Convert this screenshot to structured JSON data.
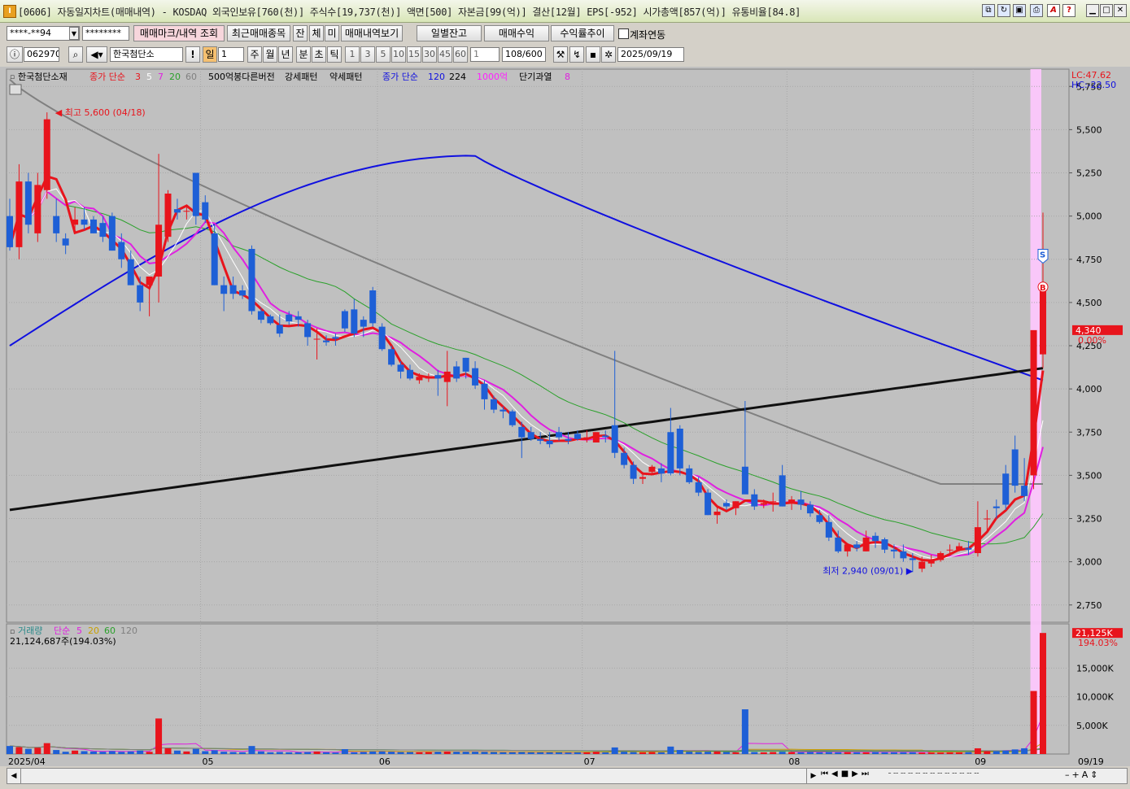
{
  "window": {
    "title": "[0606] 자동일지차트(매매내역) - KOSDAQ 외국인보유[760(천)] 주식수[19,737(천)] 액면[500] 자본금[99(억)] 결산[12월] EPS[-952] 시가총액[857(억)] 유통비율[84.8]",
    "app_icon": "I"
  },
  "toolbar1": {
    "account": "****-**94",
    "password": "********",
    "btn_trade_mark": "매매마크/내역 조회",
    "btn_recent": "최근매매종목",
    "btn_jan": "잔",
    "btn_che": "체",
    "btn_mi": "미",
    "btn_trade_list": "매매내역보기",
    "btn_daily_balance": "일별잔고",
    "btn_trade_profit": "매매수익",
    "btn_return_trend": "수익률추이",
    "chk_account_link": "계좌연동"
  },
  "toolbar2": {
    "code": "062970",
    "stock_name": "한국첨단소",
    "excl": "!",
    "period_sel": "일",
    "period_num": "1",
    "periods": [
      "주",
      "월",
      "년",
      "분",
      "초",
      "틱"
    ],
    "nums": [
      "1",
      "3",
      "5",
      "10",
      "15",
      "30",
      "45",
      "60"
    ],
    "num_sel": "1",
    "count": "108",
    "count_max": "/600",
    "date": "2025/09/19"
  },
  "legend_main": {
    "stock": "한국첨단소재",
    "ma_label": "종가 단순",
    "ma_periods": [
      "3",
      "5",
      "7",
      "20",
      "60"
    ],
    "pattern1": "500억봉다른버전",
    "pattern2": "강세패턴",
    "pattern3": "약세패턴",
    "ma2_label": "종가 단순",
    "ma2_periods": [
      "120",
      "224"
    ],
    "big": "1000억",
    "overheat": "단기과열",
    "overheat_n": "8",
    "lc": "LC:47.62",
    "hc": "HC:-22.50"
  },
  "legend_vol": {
    "label": "거래량",
    "ma_label": "단순",
    "periods": [
      "5",
      "20",
      "60",
      "120"
    ],
    "current": "21,124,687주(194.03%)"
  },
  "annotations": {
    "high": "최고 5,600 (04/18)",
    "low": "최저 2,940 (09/01)",
    "price_now": "4,340",
    "price_pct": "0.00%",
    "vol_now": "21,125K",
    "vol_pct": "194.03%",
    "sell_mark": "S",
    "buy_mark": "B"
  },
  "price_axis": [
    "5,750",
    "5,500",
    "5,250",
    "5,000",
    "4,750",
    "4,500",
    "4,250",
    "4,000",
    "3,750",
    "3,500",
    "3,250",
    "3,000",
    "2,750"
  ],
  "volume_axis": [
    "15,000K",
    "10,000K",
    "5,000K"
  ],
  "date_axis": [
    "2025/04",
    "05",
    "06",
    "07",
    "08",
    "09",
    "09/19"
  ],
  "colors": {
    "up": "#e8141c",
    "down": "#1e5fd6",
    "ma3": "#e8141c",
    "ma5": "#ffffff",
    "ma7": "#e020e0",
    "ma20": "#2aa02a",
    "ma60": "#808080",
    "ma120": "#1010e0",
    "ma224": "#101010",
    "highlight": "#ffc8ff"
  },
  "chart_data": {
    "type": "candlestick",
    "title": "",
    "xlabel": "",
    "ylabel": "",
    "ylim": [
      2650,
      5850
    ],
    "volume_ylim": [
      0,
      22000
    ],
    "start_date": "2025/04",
    "candles": [
      [
        5000,
        5100,
        4800,
        4820,
        1400
      ],
      [
        4820,
        5300,
        4750,
        5200,
        1200
      ],
      [
        5200,
        5250,
        4900,
        4950,
        900
      ],
      [
        4900,
        5250,
        4850,
        5180,
        1100
      ],
      [
        5150,
        5600,
        5100,
        5560,
        1900
      ],
      [
        5000,
        5100,
        4850,
        4900,
        700
      ],
      [
        4870,
        4900,
        4780,
        4830,
        400
      ],
      [
        4950,
        5050,
        4900,
        4980,
        600
      ],
      [
        4980,
        5050,
        4920,
        4950,
        500
      ],
      [
        4980,
        5000,
        4900,
        4900,
        450
      ],
      [
        4960,
        5000,
        4850,
        4880,
        400
      ],
      [
        5000,
        5020,
        4800,
        4800,
        500
      ],
      [
        4850,
        4900,
        4700,
        4750,
        380
      ],
      [
        4750,
        4800,
        4600,
        4600,
        450
      ],
      [
        4600,
        4650,
        4450,
        4500,
        600
      ],
      [
        4600,
        4650,
        4420,
        4650,
        380
      ],
      [
        4650,
        5360,
        4500,
        4950,
        6200
      ],
      [
        4880,
        5150,
        4850,
        5130,
        1000
      ],
      [
        5040,
        5100,
        4980,
        5020,
        600
      ],
      [
        5030,
        5060,
        4980,
        5030,
        450
      ],
      [
        5250,
        5250,
        4950,
        5000,
        900
      ],
      [
        5080,
        5120,
        4960,
        4980,
        500
      ],
      [
        4900,
        4950,
        4600,
        4600,
        650
      ],
      [
        4600,
        4650,
        4450,
        4550,
        400
      ],
      [
        4600,
        4650,
        4520,
        4550,
        350
      ],
      [
        4570,
        4600,
        4520,
        4540,
        300
      ],
      [
        4810,
        4830,
        4430,
        4450,
        1400
      ],
      [
        4450,
        4470,
        4380,
        4400,
        450
      ],
      [
        4420,
        4430,
        4370,
        4380,
        300
      ],
      [
        4370,
        4430,
        4300,
        4320,
        350
      ],
      [
        4430,
        4450,
        4370,
        4390,
        300
      ],
      [
        4420,
        4450,
        4360,
        4400,
        300
      ],
      [
        4380,
        4400,
        4250,
        4300,
        350
      ],
      [
        4290,
        4350,
        4170,
        4290,
        450
      ],
      [
        4280,
        4310,
        4250,
        4270,
        300
      ],
      [
        4300,
        4320,
        4250,
        4290,
        250
      ],
      [
        4450,
        4460,
        4330,
        4350,
        850
      ],
      [
        4460,
        4520,
        4300,
        4320,
        300
      ],
      [
        4400,
        4420,
        4300,
        4360,
        350
      ],
      [
        4570,
        4590,
        4360,
        4380,
        450
      ],
      [
        4360,
        4380,
        4220,
        4230,
        450
      ],
      [
        4230,
        4250,
        4130,
        4140,
        400
      ],
      [
        4140,
        4160,
        4060,
        4100,
        350
      ],
      [
        4110,
        4140,
        4050,
        4060,
        350
      ],
      [
        4050,
        4090,
        4030,
        4070,
        300
      ],
      [
        4060,
        4090,
        4040,
        4070,
        350
      ],
      [
        4080,
        4110,
        3960,
        4060,
        400
      ],
      [
        4040,
        4220,
        3900,
        4100,
        450
      ],
      [
        4130,
        4160,
        4040,
        4060,
        400
      ],
      [
        4180,
        4180,
        4060,
        4100,
        400
      ],
      [
        4120,
        4160,
        4000,
        4020,
        400
      ],
      [
        4030,
        4050,
        3880,
        3940,
        380
      ],
      [
        3940,
        3960,
        3860,
        3880,
        350
      ],
      [
        3880,
        3900,
        3830,
        3870,
        300
      ],
      [
        3870,
        3880,
        3780,
        3790,
        300
      ],
      [
        3780,
        3810,
        3600,
        3720,
        350
      ],
      [
        3750,
        3780,
        3700,
        3710,
        300
      ],
      [
        3710,
        3750,
        3680,
        3700,
        300
      ],
      [
        3700,
        3750,
        3660,
        3680,
        300
      ],
      [
        3750,
        3780,
        3700,
        3720,
        300
      ],
      [
        3710,
        3750,
        3680,
        3700,
        250
      ],
      [
        3740,
        3760,
        3700,
        3710,
        300
      ],
      [
        3710,
        3760,
        3690,
        3720,
        300
      ],
      [
        3690,
        3750,
        3690,
        3750,
        400
      ],
      [
        3730,
        3760,
        3690,
        3720,
        300
      ],
      [
        3790,
        4220,
        3600,
        3630,
        1150
      ],
      [
        3630,
        3660,
        3540,
        3560,
        400
      ],
      [
        3560,
        3580,
        3450,
        3480,
        350
      ],
      [
        3480,
        3520,
        3450,
        3490,
        300
      ],
      [
        3520,
        3560,
        3500,
        3550,
        350
      ],
      [
        3540,
        3570,
        3460,
        3510,
        300
      ],
      [
        3750,
        3890,
        3500,
        3510,
        1300
      ],
      [
        3770,
        3790,
        3500,
        3540,
        700
      ],
      [
        3540,
        3560,
        3450,
        3460,
        400
      ],
      [
        3460,
        3490,
        3380,
        3400,
        350
      ],
      [
        3400,
        3420,
        3270,
        3270,
        400
      ],
      [
        3270,
        3320,
        3220,
        3290,
        450
      ],
      [
        3340,
        3360,
        3300,
        3320,
        350
      ],
      [
        3310,
        3350,
        3270,
        3350,
        300
      ],
      [
        3550,
        3930,
        3400,
        3390,
        7800
      ],
      [
        3390,
        3420,
        3300,
        3320,
        350
      ],
      [
        3330,
        3360,
        3310,
        3340,
        300
      ],
      [
        3350,
        3400,
        3290,
        3350,
        350
      ],
      [
        3500,
        3560,
        3320,
        3320,
        400
      ],
      [
        3340,
        3380,
        3300,
        3360,
        350
      ],
      [
        3360,
        3410,
        3300,
        3330,
        300
      ],
      [
        3330,
        3350,
        3260,
        3280,
        350
      ],
      [
        3270,
        3300,
        3220,
        3230,
        300
      ],
      [
        3230,
        3270,
        3120,
        3140,
        350
      ],
      [
        3140,
        3180,
        3050,
        3060,
        300
      ],
      [
        3060,
        3100,
        3030,
        3100,
        350
      ],
      [
        3100,
        3120,
        3060,
        3080,
        300
      ],
      [
        3060,
        3180,
        3060,
        3140,
        300
      ],
      [
        3150,
        3170,
        3080,
        3120,
        350
      ],
      [
        3130,
        3140,
        3050,
        3070,
        300
      ],
      [
        3070,
        3100,
        3020,
        3060,
        300
      ],
      [
        3060,
        3100,
        3000,
        3020,
        300
      ],
      [
        3020,
        3050,
        2940,
        3010,
        300
      ],
      [
        2960,
        3030,
        2940,
        3000,
        250
      ],
      [
        2990,
        3040,
        2970,
        3010,
        250
      ],
      [
        3010,
        3060,
        3000,
        3050,
        250
      ],
      [
        3070,
        3100,
        3040,
        3070,
        300
      ],
      [
        3070,
        3110,
        3060,
        3090,
        300
      ],
      [
        3080,
        3120,
        3040,
        3070,
        350
      ],
      [
        3050,
        3350,
        3030,
        3200,
        1000
      ],
      [
        3250,
        3300,
        3170,
        3250,
        500
      ],
      [
        3320,
        3360,
        3250,
        3310,
        500
      ],
      [
        3510,
        3560,
        3300,
        3330,
        600
      ],
      [
        3650,
        3730,
        3400,
        3440,
        800
      ],
      [
        3440,
        3600,
        3350,
        3380,
        1000
      ],
      [
        3500,
        3650,
        3420,
        4340,
        11000
      ],
      [
        4200,
        5020,
        4120,
        4600,
        21125
      ]
    ]
  }
}
